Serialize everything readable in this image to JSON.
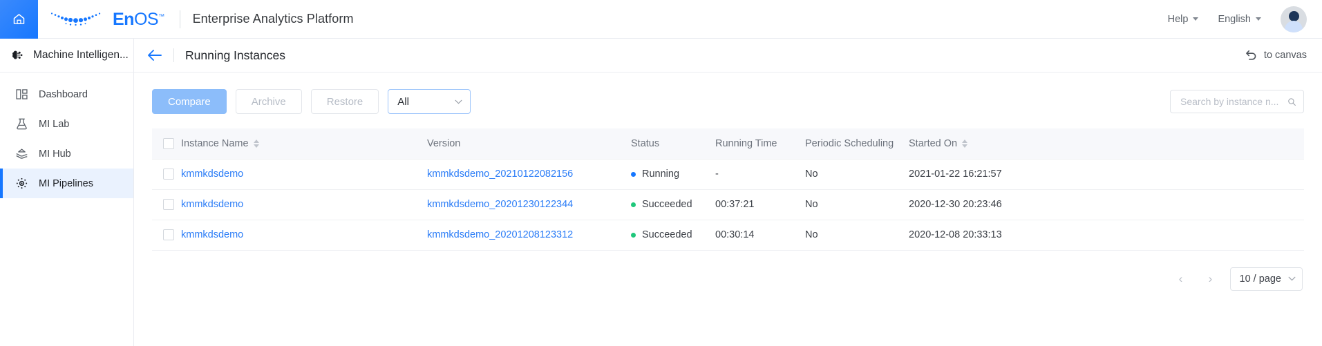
{
  "topbar": {
    "home_icon": "home-icon",
    "logo_text_en": "En",
    "logo_text_os": "OS",
    "logo_tm": "™",
    "platform_title": "Enterprise Analytics Platform",
    "help_label": "Help",
    "language_label": "English",
    "avatar": "user-avatar"
  },
  "sidebar": {
    "header_label": "Machine Intelligen...",
    "header_icon": "machine-intelligence-icon",
    "items": [
      {
        "label": "Dashboard",
        "icon": "dashboard-icon",
        "active": false
      },
      {
        "label": "MI Lab",
        "icon": "flask-icon",
        "active": false
      },
      {
        "label": "MI Hub",
        "icon": "hub-icon",
        "active": false
      },
      {
        "label": "MI Pipelines",
        "icon": "pipelines-icon",
        "active": true
      }
    ]
  },
  "page_header": {
    "back_icon": "back-arrow-icon",
    "title": "Running Instances",
    "to_canvas_label": "to canvas",
    "to_canvas_icon": "undo-icon"
  },
  "toolbar": {
    "compare_label": "Compare",
    "archive_label": "Archive",
    "restore_label": "Restore",
    "filter_value": "All",
    "filter_icon": "chevron-down-icon",
    "search_placeholder": "Search by instance n...",
    "search_value": "",
    "search_icon": "search-icon"
  },
  "table": {
    "columns": [
      {
        "key": "checkbox",
        "label": ""
      },
      {
        "key": "name",
        "label": "Instance Name",
        "sortable": true
      },
      {
        "key": "version",
        "label": "Version"
      },
      {
        "key": "status",
        "label": "Status"
      },
      {
        "key": "runtime",
        "label": "Running Time"
      },
      {
        "key": "periodic",
        "label": "Periodic Scheduling"
      },
      {
        "key": "started",
        "label": "Started On",
        "sortable": true
      }
    ],
    "rows": [
      {
        "name": "kmmkdsdemo",
        "version": "kmmkdsdemo_20210122082156",
        "status": "Running",
        "status_color": "#1677ff",
        "runtime": "-",
        "periodic": "No",
        "started": "2021-01-22 16:21:57"
      },
      {
        "name": "kmmkdsdemo",
        "version": "kmmkdsdemo_20201230122344",
        "status": "Succeeded",
        "status_color": "#1fc77b",
        "runtime": "00:37:21",
        "periodic": "No",
        "started": "2020-12-30 20:23:46"
      },
      {
        "name": "kmmkdsdemo",
        "version": "kmmkdsdemo_20201208123312",
        "status": "Succeeded",
        "status_color": "#1fc77b",
        "runtime": "00:30:14",
        "periodic": "No",
        "started": "2020-12-08 20:33:13"
      }
    ]
  },
  "pagination": {
    "prev_label": "‹",
    "next_label": "›",
    "page_size_label": "10 / page",
    "page_size_icon": "chevron-down-icon"
  },
  "colors": {
    "brand_blue": "#1677ff",
    "link_blue": "#2a7cf7",
    "active_bg": "#eaf2fe",
    "success_green": "#1fc77b",
    "header_bg": "#f7f8fb"
  }
}
